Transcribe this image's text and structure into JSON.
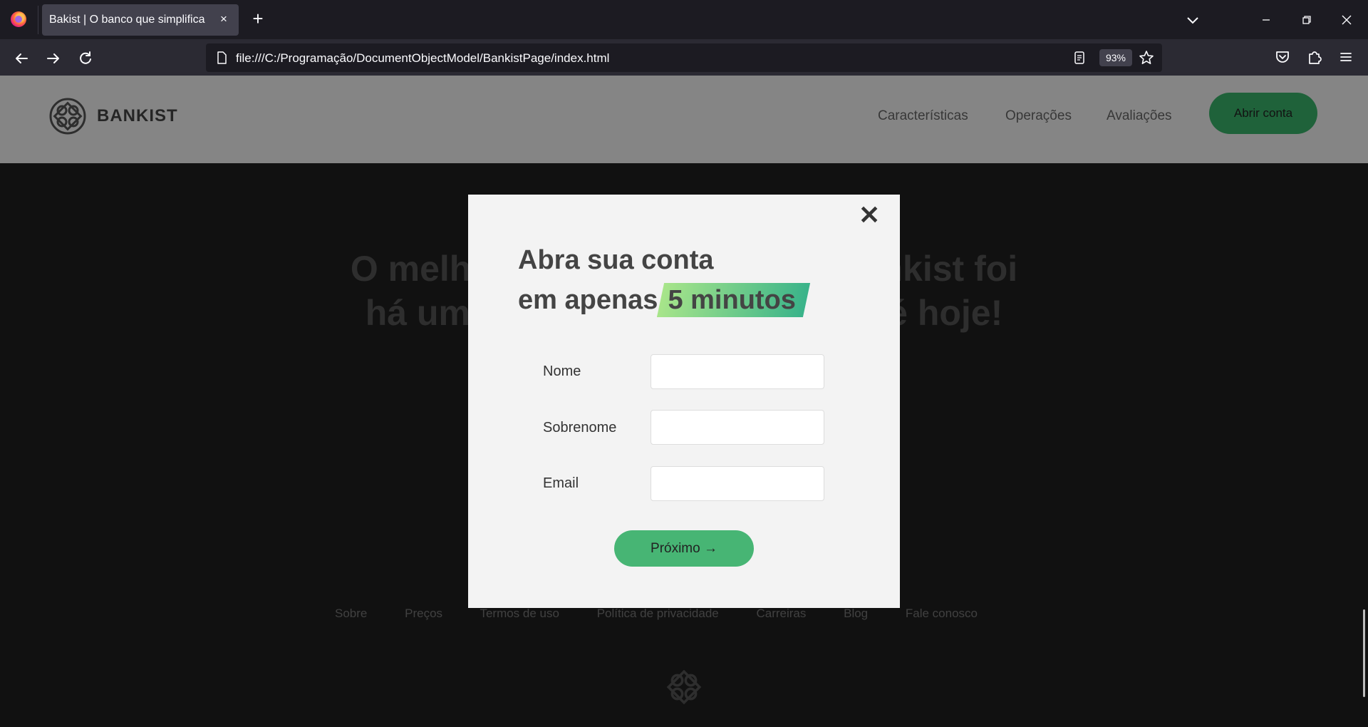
{
  "browser": {
    "tab_title": "Bakist | O banco que simplifica",
    "tab_close": "×",
    "new_tab": "+",
    "url": "file:///C:/Programação/DocumentObjectModel/BankistPage/index.html",
    "zoom": "93%",
    "icons": [
      "firefox-logo",
      "chevron-down-icon",
      "minimize-icon",
      "restore-icon",
      "close-icon",
      "back-arrow-icon",
      "forward-arrow-icon",
      "reload-icon",
      "page-icon",
      "reader-view-icon",
      "star-icon",
      "pocket-icon",
      "extensions-icon",
      "hamburger-menu-icon"
    ]
  },
  "site": {
    "brand": "BANKIST",
    "nav": [
      "Características",
      "Operações",
      "Avaliações"
    ],
    "cta": "Abrir conta",
    "hero_line1": "O melhor dia da sua vida no Bankist foi",
    "hero_line2": "há um ano. O segundo melhor é hoje!",
    "footer_links": [
      "Sobre",
      "Preços",
      "Termos de uso",
      "Política de privacidade",
      "Carreiras",
      "Blog",
      "Fale conosco"
    ],
    "accent_color": "#39b36a"
  },
  "modal": {
    "close": "✕",
    "title_line1": "Abra sua conta",
    "title_line2_prefix": "em apenas",
    "title_highlight": "5 minutos",
    "fields": [
      {
        "label": "Nome",
        "value": ""
      },
      {
        "label": "Sobrenome",
        "value": ""
      },
      {
        "label": "Email",
        "value": ""
      }
    ],
    "next_button": "Próximo →"
  }
}
